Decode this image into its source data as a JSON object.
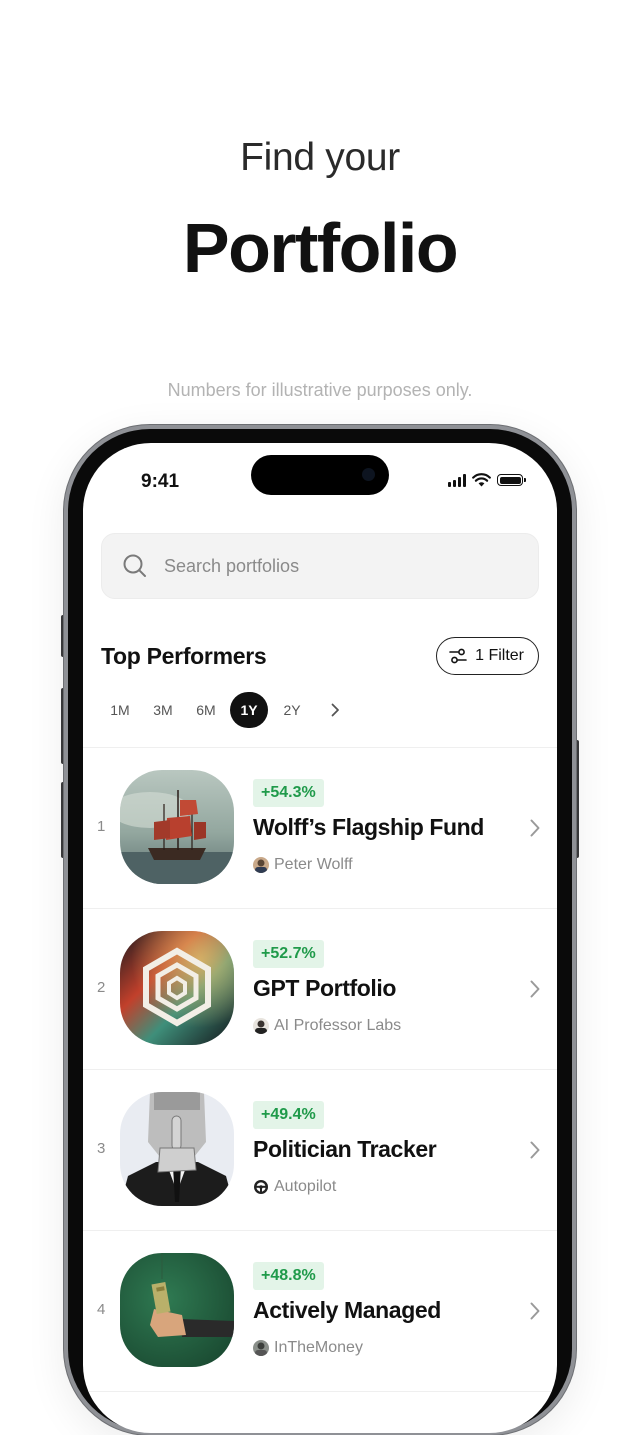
{
  "promo": {
    "line1": "Find your",
    "line2": "Portfolio",
    "disclaimer": "Numbers for illustrative purposes only."
  },
  "status_bar": {
    "time": "9:41",
    "icons": [
      "cellular-signal-icon",
      "wifi-icon",
      "battery-icon"
    ]
  },
  "search": {
    "placeholder": "Search portfolios",
    "value": ""
  },
  "section": {
    "title": "Top Performers",
    "filter_label": "1 Filter"
  },
  "periods": [
    "1M",
    "3M",
    "6M",
    "1Y",
    "2Y"
  ],
  "selected_period": "1Y",
  "colors": {
    "gain_text": "#1f9a4a",
    "gain_bg": "#e3f4e8",
    "active_chip": "#111111"
  },
  "portfolios": [
    {
      "rank": "1",
      "change": "+54.3%",
      "name": "Wolff’s Flagship Fund",
      "author": "Peter Wolff",
      "thumb": "ship-painting"
    },
    {
      "rank": "2",
      "change": "+52.7%",
      "name": "GPT Portfolio",
      "author": "AI Professor Labs",
      "thumb": "hexagon-logo"
    },
    {
      "rank": "3",
      "change": "+49.4%",
      "name": "Politician Tracker",
      "author": "Autopilot",
      "thumb": "shushing-man"
    },
    {
      "rank": "4",
      "change": "+48.8%",
      "name": "Actively Managed",
      "author": "InTheMoney",
      "thumb": "hand-with-cash"
    }
  ]
}
